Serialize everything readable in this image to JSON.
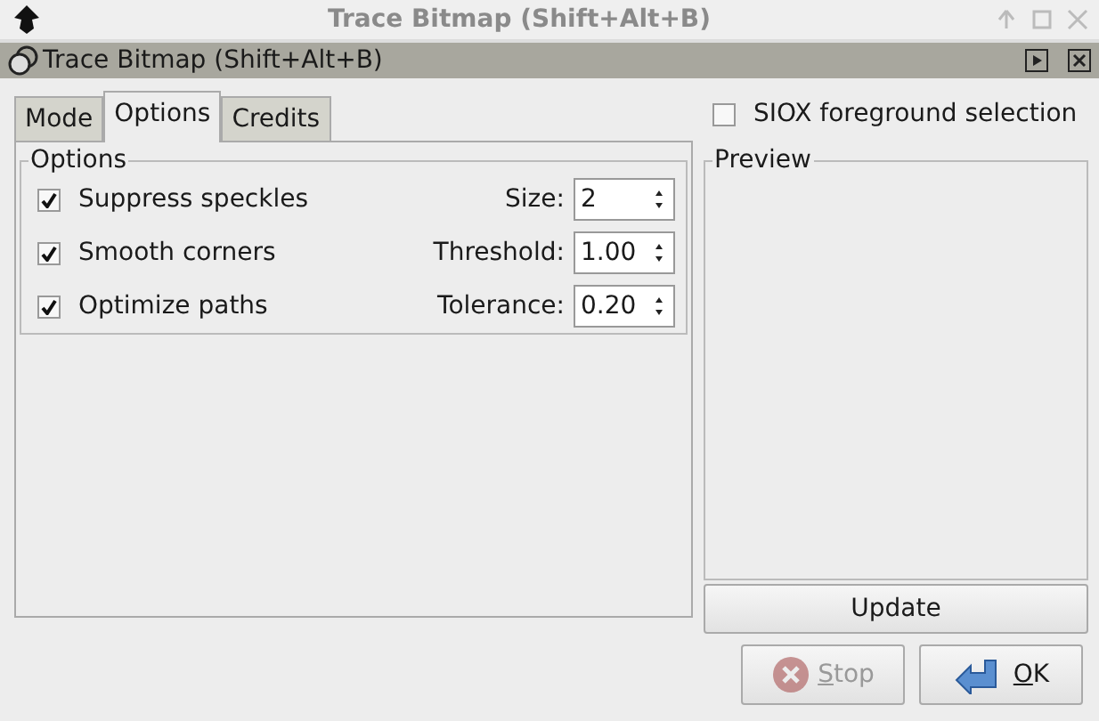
{
  "window": {
    "title": "Trace Bitmap (Shift+Alt+B)"
  },
  "dock": {
    "title": "Trace Bitmap (Shift+Alt+B)"
  },
  "tabs": [
    {
      "label": "Mode",
      "selected": false
    },
    {
      "label": "Options",
      "selected": true
    },
    {
      "label": "Credits",
      "selected": false
    }
  ],
  "options": {
    "title": "Options",
    "rows": [
      {
        "label": "Suppress speckles",
        "checked": true,
        "field_label": "Size:",
        "value": "2"
      },
      {
        "label": "Smooth corners",
        "checked": true,
        "field_label": "Threshold:",
        "value": "1.00"
      },
      {
        "label": "Optimize paths",
        "checked": true,
        "field_label": "Tolerance:",
        "value": "0.20"
      }
    ]
  },
  "siox": {
    "label": "SIOX foreground selection",
    "checked": false
  },
  "preview": {
    "title": "Preview",
    "button": "Update"
  },
  "buttons": [
    {
      "label": "Stop",
      "kind": "stop",
      "disabled": true
    },
    {
      "label": "OK",
      "kind": "ok",
      "disabled": false
    }
  ]
}
